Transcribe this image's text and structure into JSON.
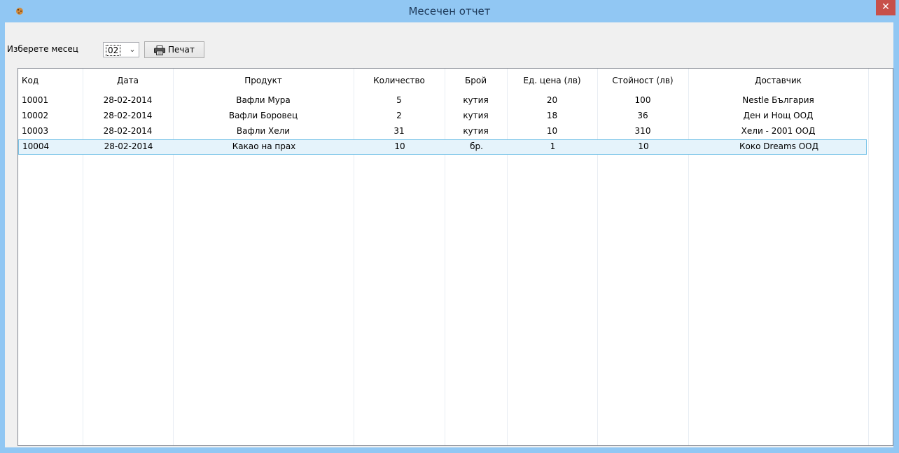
{
  "window": {
    "title": "Месечен отчет",
    "app_icon": "cookie-icon",
    "close_symbol": "✕"
  },
  "toolbar": {
    "month_label": "Изберете месец",
    "month_value": "02",
    "dropdown_icon": "chevron-down-icon",
    "print_label": "Печат",
    "print_icon": "printer-icon"
  },
  "table": {
    "columns": [
      "Код",
      "Дата",
      "Продукт",
      "Количество",
      "Брой",
      "Ед. цена (лв)",
      "Стойност (лв)",
      "Доставчик"
    ],
    "rows": [
      [
        "10001",
        "28-02-2014",
        "Вафли Мура",
        "5",
        "кутия",
        "20",
        "100",
        "Nestle България"
      ],
      [
        "10002",
        "28-02-2014",
        "Вафли Боровец",
        "2",
        "кутия",
        "18",
        "36",
        "Ден и Нощ ООД"
      ],
      [
        "10003",
        "28-02-2014",
        "Вафли Хели",
        "31",
        "кутия",
        "10",
        "310",
        "Хели - 2001 ООД"
      ],
      [
        "10004",
        "28-02-2014",
        "Какао на прах",
        "10",
        "бр.",
        "1",
        "10",
        "Коко Dreams ООД"
      ]
    ],
    "selected_row": 3
  },
  "colors": {
    "titlebar": "#91c7f3",
    "close_button": "#c7504a",
    "selection_bg": "#e5f3fb",
    "selection_border": "#7ac4e8"
  }
}
